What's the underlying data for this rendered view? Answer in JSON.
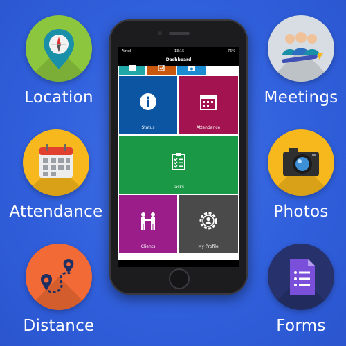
{
  "features_left": [
    {
      "label": "Location",
      "icon": "map-pin-compass-icon",
      "color": "#8cc63e"
    },
    {
      "label": "Attendance",
      "icon": "calendar-icon",
      "color": "#f6b81c"
    },
    {
      "label": "Distance",
      "icon": "route-icon",
      "color": "#f26a35"
    }
  ],
  "features_right": [
    {
      "label": "Meetings",
      "icon": "people-icon",
      "color": "#d7dde2"
    },
    {
      "label": "Photos",
      "icon": "camera-icon",
      "color": "#f6b81c"
    },
    {
      "label": "Forms",
      "icon": "form-document-icon",
      "color": "#27316b"
    }
  ],
  "phone": {
    "status": {
      "carrier": "Airtel",
      "time": "13:15",
      "battery": "76%"
    },
    "title": "Dashboard",
    "tiles": [
      {
        "label": "Status",
        "icon": "info-icon",
        "color": "#0c55a2"
      },
      {
        "label": "Attendance",
        "icon": "calendar-icon",
        "color": "#a3134f"
      },
      {
        "label": "Tasks",
        "icon": "checklist-icon",
        "color": "#1a9845"
      },
      {
        "label": "Clients",
        "icon": "handshake-icon",
        "color": "#9a1d8a"
      },
      {
        "label": "My Profile",
        "icon": "profile-gear-icon",
        "color": "#4a4a4a"
      }
    ],
    "top_tiles": [
      "#20a8a8",
      "#c9580e",
      "#1b8bd2"
    ]
  }
}
